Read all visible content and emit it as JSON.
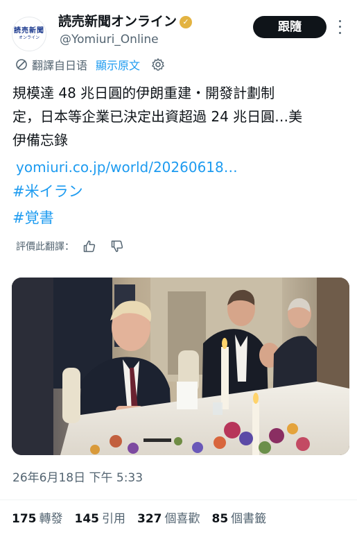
{
  "account": {
    "display_name": "読売新聞オンライン",
    "handle": "@Yomiuri_Online",
    "avatar_text_line1": "読売新聞",
    "avatar_text_line2": "オンライン",
    "verified_icon": "gold-check-badge"
  },
  "actions": {
    "follow_label": "跟隨",
    "more_icon": "more-vertical-icon"
  },
  "translation": {
    "label": "翻譯自日语",
    "show_original": "顯示原文",
    "rate_label": "評價此翻譯：",
    "thumbs_up_icon": "thumbs-up-icon",
    "thumbs_down_icon": "thumbs-down-icon"
  },
  "post": {
    "lines": [
      "規模達 48 兆日圓的伊朗重建・開發計劃制",
      "定，日本等企業已決定出資超過 24 兆日圓…美",
      "伊備忘錄"
    ],
    "link": "yomiuri.co.jp/world/20260618…",
    "hashtags": [
      "#米イラン",
      "#覚書"
    ]
  },
  "timestamp": "26年6月18日 下午 5:33",
  "stats": [
    {
      "count": "175",
      "label": "轉發"
    },
    {
      "count": "145",
      "label": "引用"
    },
    {
      "count": "327",
      "label": "個喜歡"
    },
    {
      "count": "85",
      "label": "個書籤"
    }
  ],
  "colors": {
    "link_blue": "#1d9bf0",
    "secondary_text": "#536471",
    "primary_text": "#0f1419",
    "follow_button_bg": "#0f1419",
    "verified_gold": "#e3b341"
  }
}
